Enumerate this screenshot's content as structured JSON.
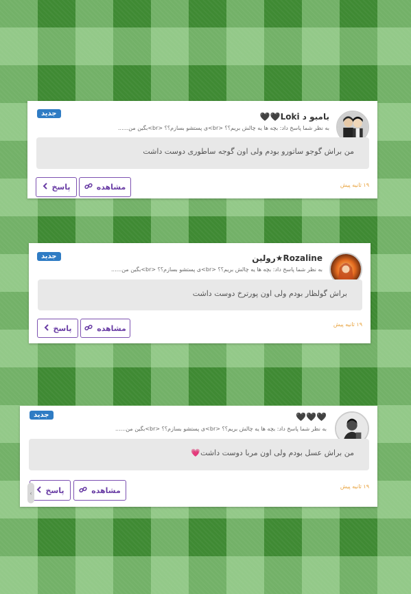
{
  "notifications": [
    {
      "name": "بامبو د Loki🖤🖤",
      "badge": "جدید",
      "subtitle": "به نظر شما پاسخ داد: بچه ها یه چالش بریم؟؟ <br>ی پستشو بسازم؟؟ <br>بگین من......",
      "quote": "من براش گوجو ساتورو بودم ولی اون گوجه ساطوری دوست داشت",
      "time": "۱۹ ثانیه پیش",
      "view_label": "مشاهده",
      "reply_label": "پاسخ"
    },
    {
      "name": "Rozaline★رولین",
      "badge": "جدید",
      "subtitle": "به نظر شما پاسخ داد: بچه ها یه چالش بریم؟؟ <br>ی پستشو بسازم؟؟ <br>بگین من......",
      "quote": "براش گولظار بودم ولی اون پورترخ دوست داشت",
      "time": "۱۹ ثانیه پیش",
      "view_label": "مشاهده",
      "reply_label": "پاسخ"
    },
    {
      "name": "🖤🖤🖤",
      "badge": "جدید",
      "subtitle": "به نظر شما پاسخ داد: بچه ها یه چالش بریم؟؟ <br>ی پستشو بسازم؟؟ <br>بگین من......",
      "quote": "من براش عسل بودم ولی اون مربا دوست داشت💗",
      "time": "۱۹ ثانیه پیش",
      "view_label": "مشاهده",
      "reply_label": "پاسخ"
    }
  ],
  "icons": {
    "link": "link-icon",
    "reply": "chevron-left-icon"
  },
  "colors": {
    "badge": "#2f7cc4",
    "button_border": "#7b4fb0",
    "time": "#e8a13a"
  }
}
